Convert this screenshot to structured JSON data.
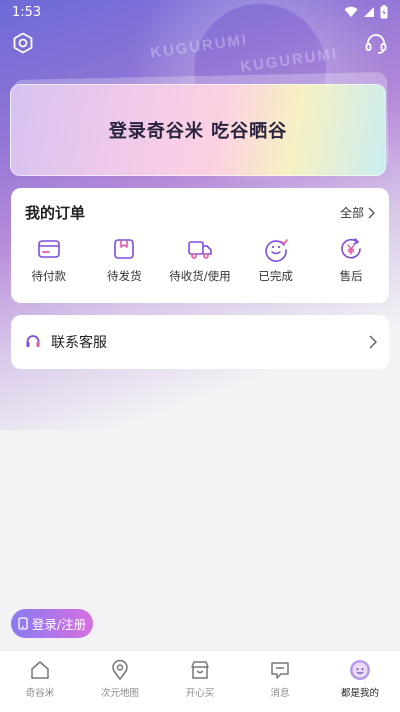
{
  "status_bar": {
    "time": "1:53"
  },
  "hero": {
    "brand_text": "KUGURUMI"
  },
  "login_card": {
    "text": "登录奇谷米 吃谷晒谷"
  },
  "orders": {
    "title": "我的订单",
    "all_label": "全部",
    "items": [
      {
        "label": "待付款",
        "icon": "wallet-icon"
      },
      {
        "label": "待发货",
        "icon": "package-icon"
      },
      {
        "label": "待收货/使用",
        "icon": "truck-icon"
      },
      {
        "label": "已完成",
        "icon": "smile-check-icon"
      },
      {
        "label": "售后",
        "icon": "yen-return-icon"
      }
    ]
  },
  "service": {
    "label": "联系客服"
  },
  "float_button": {
    "label": "登录/注册"
  },
  "nav": {
    "items": [
      {
        "label": "奇谷米",
        "icon": "home-icon"
      },
      {
        "label": "次元地图",
        "icon": "map-pin-icon"
      },
      {
        "label": "开心买",
        "icon": "shop-icon"
      },
      {
        "label": "消息",
        "icon": "message-icon"
      },
      {
        "label": "都是我的",
        "icon": "avatar-icon",
        "active": true
      }
    ]
  },
  "colors": {
    "accent": "#8b5cf6",
    "gradient_start": "#8a7bf0",
    "gradient_end": "#d66fe0"
  }
}
